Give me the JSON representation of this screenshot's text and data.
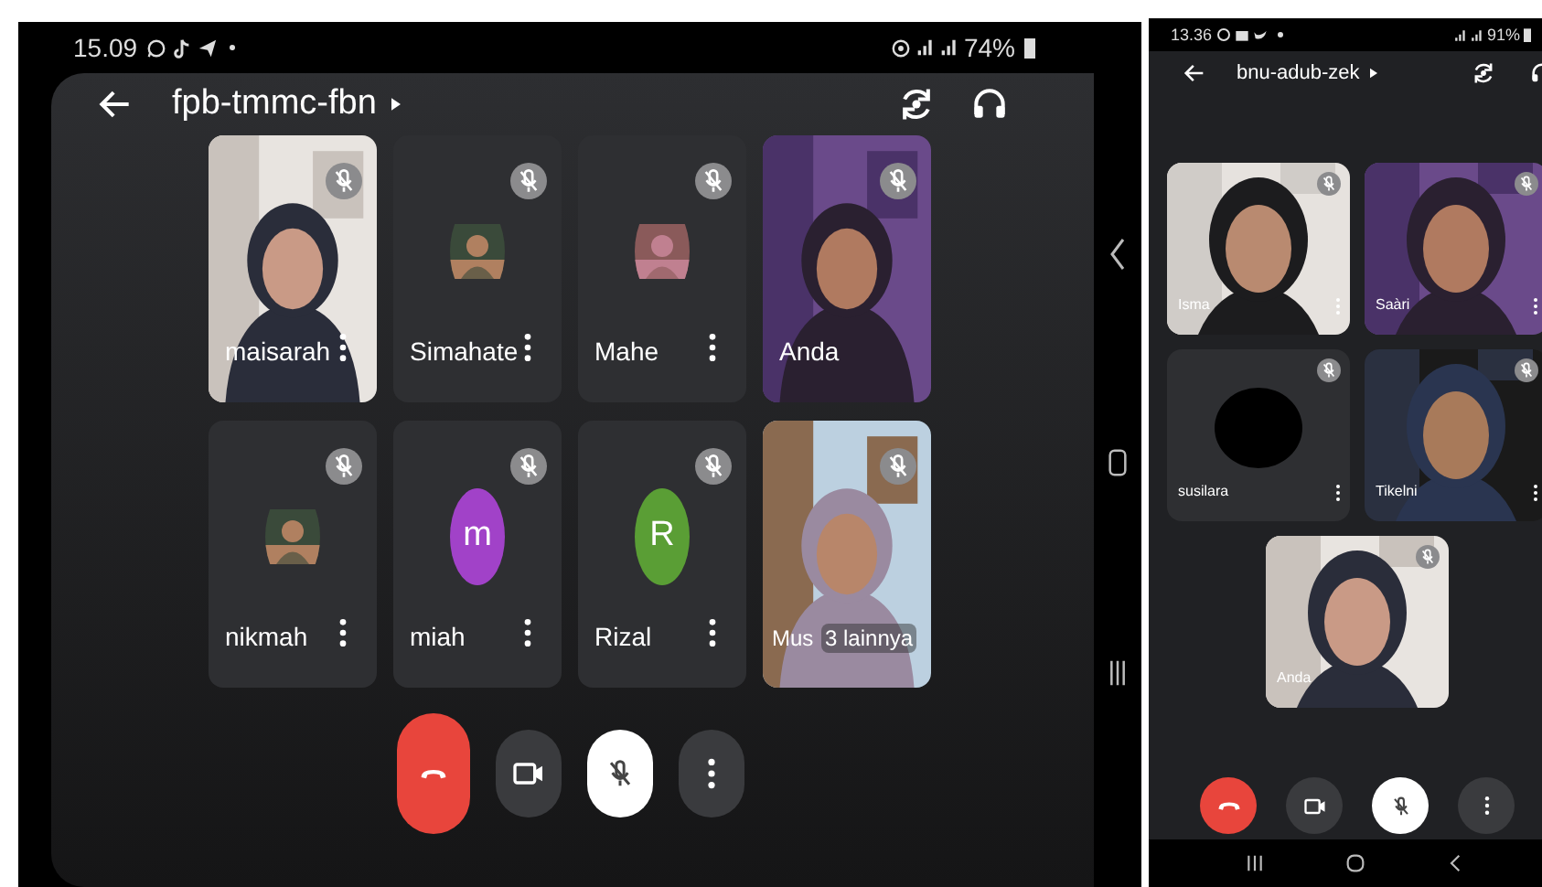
{
  "left_phone": {
    "status_bar": {
      "time": "15.09",
      "battery": "74%"
    },
    "meeting_code": "fpb-tmmc-fbn",
    "mic_muted": true,
    "tiles": [
      {
        "kind": "video",
        "name": "maisarah",
        "muted": true,
        "menu": true
      },
      {
        "kind": "avatar-photo",
        "name": "Simahate",
        "muted": true,
        "menu": true
      },
      {
        "kind": "avatar-photo",
        "name": "Mahe",
        "muted": true,
        "menu": true
      },
      {
        "kind": "video",
        "name": "Anda",
        "muted": true,
        "menu": false
      },
      {
        "kind": "avatar-photo",
        "name": "nikmah",
        "muted": true,
        "menu": true
      },
      {
        "kind": "avatar-letter",
        "name": "miah",
        "letter": "m",
        "color": "#a142c8",
        "muted": true,
        "menu": true
      },
      {
        "kind": "avatar-letter",
        "name": "Rizal",
        "letter": "R",
        "color": "#5a9e35",
        "muted": true,
        "menu": true
      },
      {
        "kind": "video",
        "name": "Mus",
        "overlay": "3 lainnya",
        "muted": true,
        "menu": false
      }
    ]
  },
  "right_phone": {
    "status_bar": {
      "time": "13.36",
      "battery": "91%"
    },
    "meeting_code": "bnu-adub-zek",
    "mic_muted": true,
    "tiles": [
      {
        "kind": "video",
        "name": "Isma",
        "muted": true,
        "menu": true
      },
      {
        "kind": "video",
        "name": "Saàri",
        "muted": true,
        "menu": true
      },
      {
        "kind": "avatar-blank",
        "name": "susilara",
        "muted": true,
        "menu": true
      },
      {
        "kind": "video",
        "name": "Tikelni",
        "muted": true,
        "menu": true
      },
      {
        "kind": "video",
        "name": "Anda",
        "muted": true,
        "menu": false
      }
    ]
  }
}
